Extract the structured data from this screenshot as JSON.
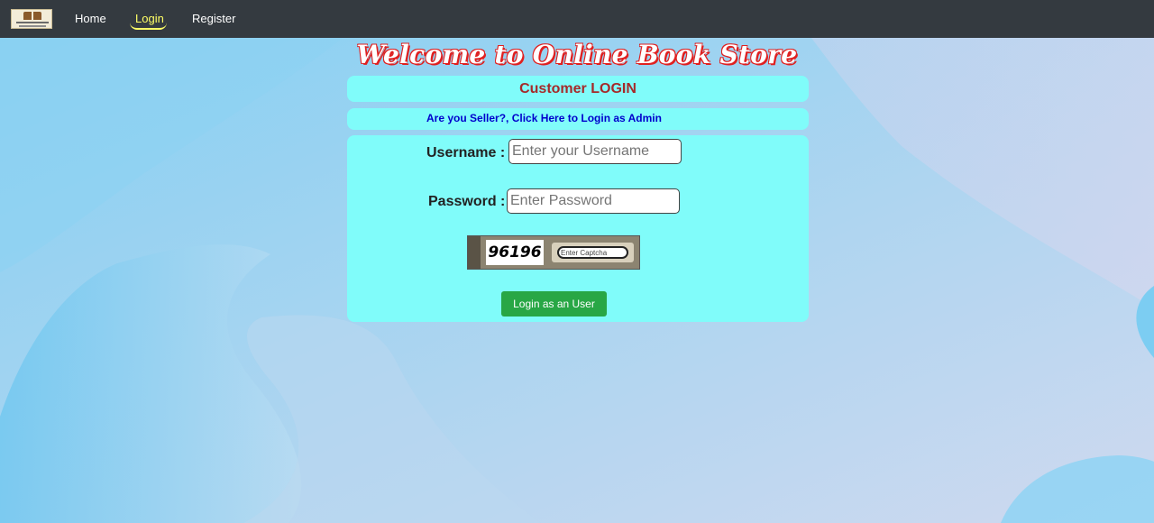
{
  "navbar": {
    "logo_alt": "Online Book Store",
    "links": [
      {
        "label": "Home"
      },
      {
        "label": "Login"
      },
      {
        "label": "Register"
      }
    ]
  },
  "header": {
    "welcome": "Welcome to Online Book Store"
  },
  "login": {
    "title": "Customer LOGIN",
    "seller_link": "Are you Seller?, Click Here to Login as Admin",
    "username_label": "Username :",
    "username_placeholder": "Enter your Username",
    "password_label": "Password :",
    "password_placeholder": "Enter Password",
    "captcha_code": "96196",
    "captcha_placeholder": "Enter Captcha",
    "submit_label": "Login as an User"
  },
  "colors": {
    "navbar": "#343a40",
    "panel": "#80fcfa",
    "title": "#a52a2a",
    "link": "#0000cc",
    "button": "#28a745",
    "active_nav": "#ffff66"
  }
}
